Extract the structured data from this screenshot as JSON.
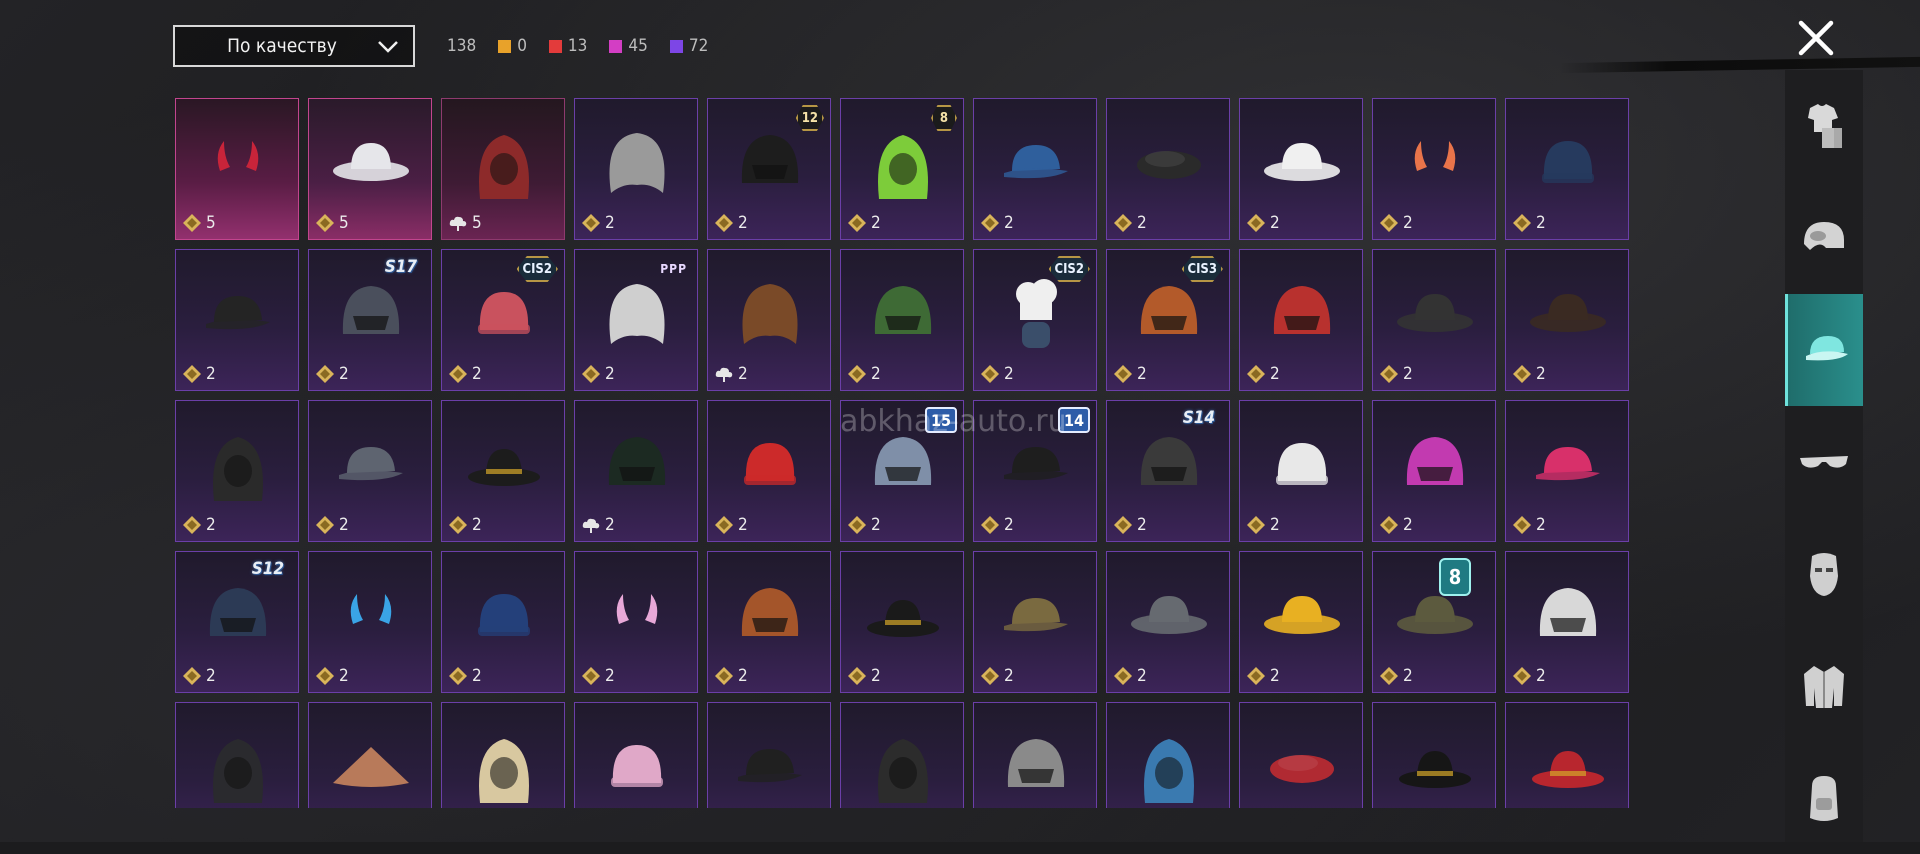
{
  "header": {
    "sort_label": "По качеству",
    "total_count": "138",
    "quality_stats": [
      {
        "color": "#e8a22a",
        "value": "0"
      },
      {
        "color": "#e33b3b",
        "value": "13"
      },
      {
        "color": "#d33ec4",
        "value": "45"
      },
      {
        "color": "#7d46e6",
        "value": "72"
      }
    ]
  },
  "watermark": "abkhaz-auto.ru",
  "colors": {
    "accent_teal": "#2a8f8c",
    "epic_border": "#6b3fa8",
    "legendary_border": "#c2458e"
  },
  "sidebar_tabs": [
    {
      "name": "outfit-icon",
      "active": false
    },
    {
      "name": "helmet-icon",
      "active": false
    },
    {
      "name": "cap-icon",
      "active": true
    },
    {
      "name": "glasses-icon",
      "active": false
    },
    {
      "name": "face-mask-icon",
      "active": false
    },
    {
      "name": "jacket-icon",
      "active": false
    },
    {
      "name": "backpack-icon",
      "active": false
    }
  ],
  "items": [
    {
      "id": "devil-horns",
      "count": "5",
      "rarity": "red",
      "cur": "coin"
    },
    {
      "id": "white-panama",
      "count": "5",
      "rarity": "pink",
      "cur": "coin"
    },
    {
      "id": "chicken-hood",
      "count": "5",
      "rarity": "rose",
      "cur": "cloud"
    },
    {
      "id": "grey-hair",
      "count": "2",
      "rarity": "epic",
      "cur": "coin"
    },
    {
      "id": "bunny-helmet",
      "count": "2",
      "rarity": "epic",
      "cur": "coin",
      "badge": "12",
      "badge_type": "hex"
    },
    {
      "id": "skull-hood",
      "count": "2",
      "rarity": "epic",
      "cur": "coin",
      "badge": "8",
      "badge_type": "hex"
    },
    {
      "id": "blue-cap",
      "count": "2",
      "rarity": "epic",
      "cur": "coin"
    },
    {
      "id": "black-beret",
      "count": "2",
      "rarity": "epic",
      "cur": "coin"
    },
    {
      "id": "sun-hat",
      "count": "2",
      "rarity": "epic",
      "cur": "coin"
    },
    {
      "id": "cat-ears",
      "count": "2",
      "rarity": "epic",
      "cur": "coin"
    },
    {
      "id": "navy-beanie",
      "count": "2",
      "rarity": "epic",
      "cur": "coin"
    },
    {
      "id": "black-cap",
      "count": "2",
      "rarity": "epic",
      "cur": "coin"
    },
    {
      "id": "horned-helmet",
      "count": "2",
      "rarity": "epic",
      "cur": "coin",
      "badge": "S17",
      "badge_type": "s"
    },
    {
      "id": "striped-beanie",
      "count": "2",
      "rarity": "epic",
      "cur": "coin",
      "badge": "CIS2",
      "badge_type": "cis"
    },
    {
      "id": "silver-bob",
      "count": "2",
      "rarity": "epic",
      "cur": "coin",
      "badge": "PPP",
      "badge_type": "ppp"
    },
    {
      "id": "braided-hair",
      "count": "2",
      "rarity": "epic",
      "cur": "cloud"
    },
    {
      "id": "green-helmet",
      "count": "2",
      "rarity": "epic",
      "cur": "coin"
    },
    {
      "id": "chef-mask",
      "count": "2",
      "rarity": "epic",
      "cur": "coin",
      "badge": "CIS2",
      "badge_type": "cis"
    },
    {
      "id": "robot-head",
      "count": "2",
      "rarity": "epic",
      "cur": "coin",
      "badge": "CIS3",
      "badge_type": "cis"
    },
    {
      "id": "red-moto-helmet",
      "count": "2",
      "rarity": "epic",
      "cur": "coin"
    },
    {
      "id": "sombrero",
      "count": "2",
      "rarity": "epic",
      "cur": "coin"
    },
    {
      "id": "steampunk-hat",
      "count": "2",
      "rarity": "epic",
      "cur": "coin"
    },
    {
      "id": "tribal-mask",
      "count": "2",
      "rarity": "epic",
      "cur": "coin"
    },
    {
      "id": "grey-cap",
      "count": "2",
      "rarity": "epic",
      "cur": "coin"
    },
    {
      "id": "gold-fedora",
      "count": "2",
      "rarity": "epic",
      "cur": "coin"
    },
    {
      "id": "green-visor-helmet",
      "count": "2",
      "rarity": "epic",
      "cur": "cloud"
    },
    {
      "id": "bandana-head",
      "count": "2",
      "rarity": "epic",
      "cur": "coin"
    },
    {
      "id": "gladiator-helmet",
      "count": "2",
      "rarity": "epic",
      "cur": "coin",
      "badge": "15",
      "badge_type": "blue"
    },
    {
      "id": "police-cap",
      "count": "2",
      "rarity": "epic",
      "cur": "coin",
      "badge": "14",
      "badge_type": "blue"
    },
    {
      "id": "knight-helmet",
      "count": "2",
      "rarity": "epic",
      "cur": "coin",
      "badge": "S14",
      "badge_type": "s"
    },
    {
      "id": "white-turban",
      "count": "2",
      "rarity": "epic",
      "cur": "coin"
    },
    {
      "id": "spiked-pink-helmet",
      "count": "2",
      "rarity": "epic",
      "cur": "coin"
    },
    {
      "id": "pink-cap",
      "count": "2",
      "rarity": "epic",
      "cur": "coin"
    },
    {
      "id": "astro-helmet",
      "count": "2",
      "rarity": "epic",
      "cur": "coin",
      "badge": "S12",
      "badge_type": "s"
    },
    {
      "id": "blue-bunny-band",
      "count": "2",
      "rarity": "epic",
      "cur": "coin"
    },
    {
      "id": "blue-beanie",
      "count": "2",
      "rarity": "epic",
      "cur": "coin"
    },
    {
      "id": "cat-headphones",
      "count": "2",
      "rarity": "epic",
      "cur": "coin"
    },
    {
      "id": "football-helmet",
      "count": "2",
      "rarity": "epic",
      "cur": "coin"
    },
    {
      "id": "pirate-hat",
      "count": "2",
      "rarity": "epic",
      "cur": "coin"
    },
    {
      "id": "camo-cap",
      "count": "2",
      "rarity": "epic",
      "cur": "coin"
    },
    {
      "id": "grey-bucket",
      "count": "2",
      "rarity": "epic",
      "cur": "coin"
    },
    {
      "id": "yellow-bucket",
      "count": "2",
      "rarity": "epic",
      "cur": "coin"
    },
    {
      "id": "boonie-hat",
      "count": "2",
      "rarity": "epic",
      "cur": "coin",
      "badge": "8",
      "badge_type": "teal"
    },
    {
      "id": "soccer-ball-mask",
      "count": "2",
      "rarity": "epic",
      "cur": "coin"
    },
    {
      "id": "anubis-mask",
      "count": "",
      "rarity": "epic",
      "cur": "none"
    },
    {
      "id": "conical-hat",
      "count": "",
      "rarity": "epic",
      "cur": "none"
    },
    {
      "id": "jester-mask",
      "count": "",
      "rarity": "epic",
      "cur": "none"
    },
    {
      "id": "cake-hat",
      "count": "",
      "rarity": "epic",
      "cur": "none"
    },
    {
      "id": "dark-cap",
      "count": "",
      "rarity": "epic",
      "cur": "none"
    },
    {
      "id": "balaclava",
      "count": "",
      "rarity": "epic",
      "cur": "none"
    },
    {
      "id": "luchador-mask",
      "count": "",
      "rarity": "epic",
      "cur": "none"
    },
    {
      "id": "shark-hat",
      "count": "",
      "rarity": "epic",
      "cur": "none"
    },
    {
      "id": "red-beret",
      "count": "",
      "rarity": "epic",
      "cur": "none"
    },
    {
      "id": "top-hat",
      "count": "",
      "rarity": "epic",
      "cur": "none"
    },
    {
      "id": "red-fedora",
      "count": "",
      "rarity": "epic",
      "cur": "none"
    }
  ]
}
